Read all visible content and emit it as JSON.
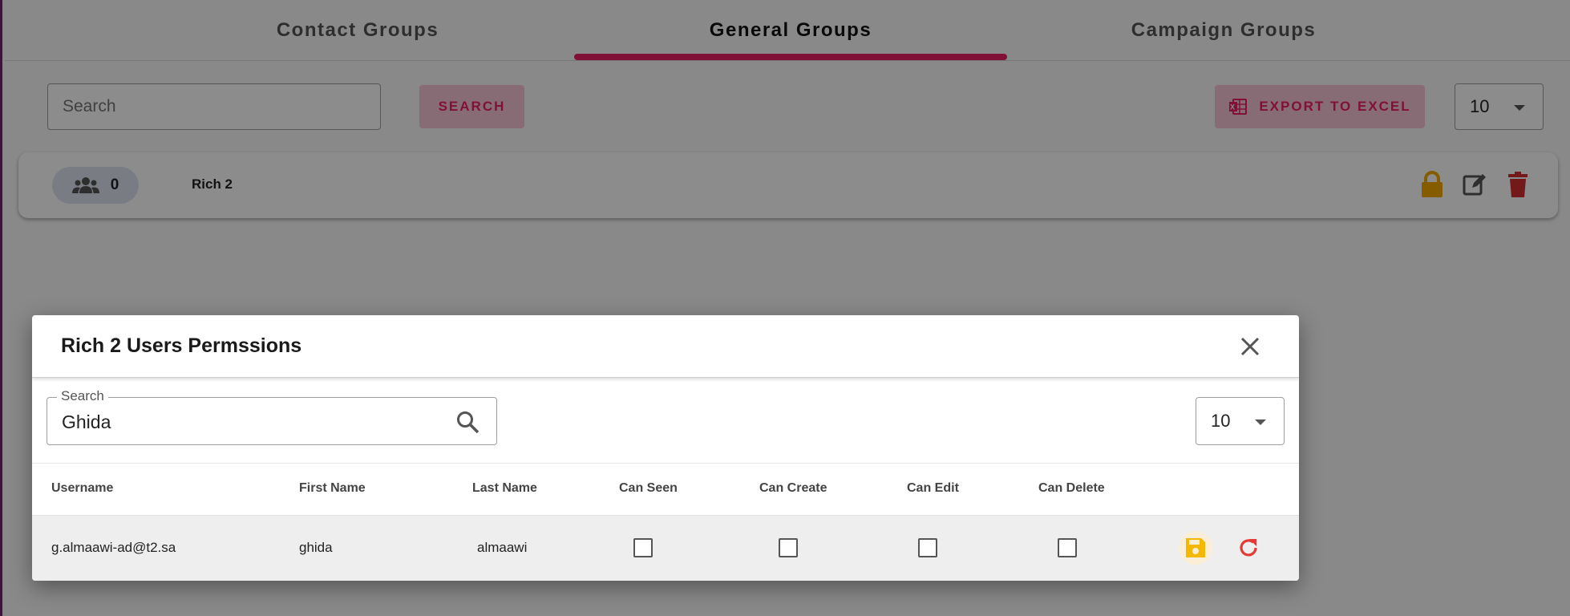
{
  "tabs": [
    {
      "label": "Contact Groups"
    },
    {
      "label": "General Groups"
    },
    {
      "label": "Campaign Groups"
    }
  ],
  "toolbar": {
    "search_placeholder": "Search",
    "search_button": "SEARCH",
    "export_button": "EXPORT TO EXCEL",
    "page_size": "10"
  },
  "group": {
    "member_count": "0",
    "name": "Rich 2"
  },
  "dialog": {
    "title": "Rich 2 Users Permssions",
    "search_label": "Search",
    "search_value": "Ghida",
    "page_size": "10",
    "columns": [
      "Username",
      "First Name",
      "Last Name",
      "Can Seen",
      "Can Create",
      "Can Edit",
      "Can Delete"
    ],
    "rows": [
      {
        "username": "g.almaawi-ad@t2.sa",
        "first_name": "ghida",
        "last_name": "almaawi",
        "can_seen": false,
        "can_create": false,
        "can_edit": false,
        "can_delete": false
      }
    ]
  },
  "colors": {
    "accent": "#e91e63",
    "lock": "#f2a900",
    "delete": "#d32f2f",
    "save": "#f5b800",
    "refresh": "#e53935"
  }
}
